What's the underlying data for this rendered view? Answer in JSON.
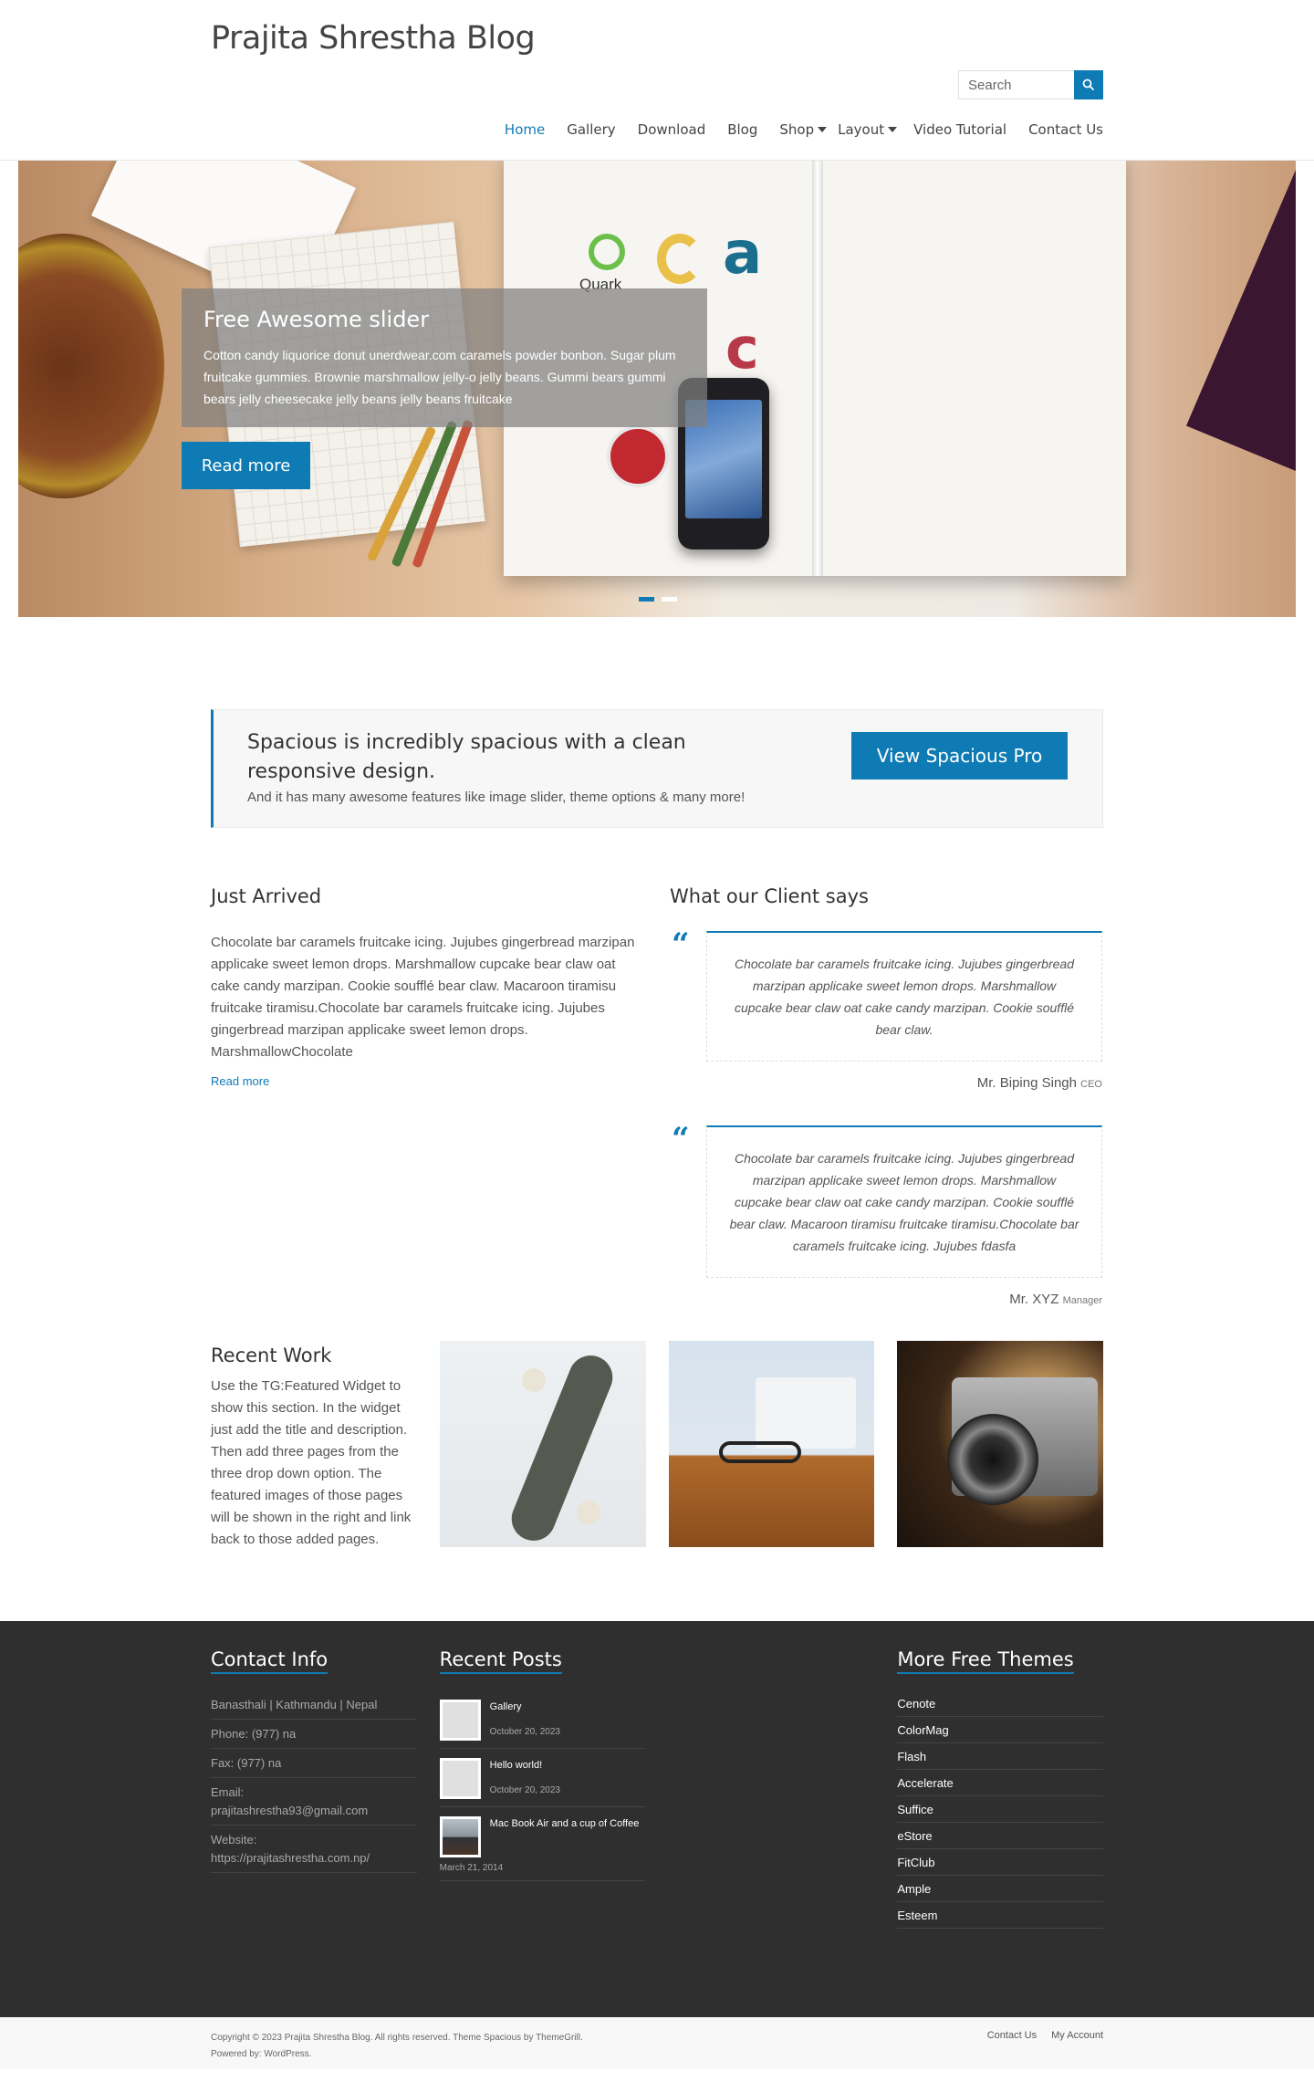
{
  "site": {
    "title": "Prajita Shrestha Blog"
  },
  "search": {
    "placeholder": "Search"
  },
  "nav": {
    "items": [
      "Home",
      "Gallery",
      "Download",
      "Blog",
      "Shop",
      "Layout",
      "Video Tutorial",
      "Contact Us"
    ],
    "active": "Home"
  },
  "slider": {
    "title": "Free Awesome slider",
    "description": "Cotton candy liquorice donut unerdwear.com caramels powder bonbon. Sugar plum fruitcake gummies. Brownie marshmallow jelly-o jelly beans. Gummi bears gummi bears jelly cheesecake jelly beans jelly beans fruitcake",
    "button": "Read more",
    "image_text": {
      "quark": "Quark"
    }
  },
  "cta": {
    "title": "Spacious is incredibly spacious with a clean responsive design.",
    "subtitle": "And it has many awesome features like image slider, theme options & many more!",
    "button": "View Spacious Pro"
  },
  "just_arrived": {
    "heading": "Just Arrived",
    "text": "Chocolate bar caramels fruitcake icing. Jujubes gingerbread marzipan applicake sweet lemon drops. Marshmallow cupcake bear claw oat cake candy marzipan. Cookie soufflé bear claw. Macaroon tiramisu fruitcake tiramisu.Chocolate bar caramels fruitcake icing. Jujubes gingerbread marzipan applicake sweet lemon drops. MarshmallowChocolate",
    "read_more": "Read more"
  },
  "testimonials": {
    "heading": "What our Client says",
    "items": [
      {
        "quote": "Chocolate bar caramels fruitcake icing. Jujubes gingerbread marzipan applicake sweet lemon drops. Marshmallow cupcake bear claw oat cake candy marzipan. Cookie soufflé bear claw.",
        "name": "Mr. Biping Singh",
        "role": "CEO"
      },
      {
        "quote": "Chocolate bar caramels fruitcake icing. Jujubes gingerbread marzipan applicake sweet lemon drops. Marshmallow cupcake bear claw oat cake candy marzipan. Cookie soufflé bear claw. Macaroon tiramisu fruitcake tiramisu.Chocolate bar caramels fruitcake icing. Jujubes fdasfa",
        "name": "Mr. XYZ",
        "role": "Manager"
      }
    ]
  },
  "recent_work": {
    "heading": "Recent Work",
    "text": "Use the TG:Featured Widget to show this section. In the widget just add the title and description. Then add three pages from the three drop down option. The featured images of those pages will be shown in the right and link back to those added pages."
  },
  "footer": {
    "contact": {
      "heading": "Contact Info",
      "address": "Banasthali | Kathmandu | Nepal",
      "phone": "Phone: (977) na",
      "fax": "Fax: (977) na",
      "email_label": "Email:",
      "email": "prajitashrestha93@gmail.com",
      "website_label": "Website:",
      "website": "https://prajitashrestha.com.np/"
    },
    "recent_posts": {
      "heading": "Recent Posts",
      "items": [
        {
          "title": "Gallery",
          "date": "October 20, 2023"
        },
        {
          "title": "Hello world!",
          "date": "October 20, 2023"
        },
        {
          "title": "Mac Book Air and a cup of Coffee",
          "date": "March 21, 2014"
        }
      ]
    },
    "themes": {
      "heading": "More Free Themes",
      "items": [
        "Cenote",
        "ColorMag",
        "Flash",
        "Accelerate",
        "Suffice",
        "eStore",
        "FitClub",
        "Ample",
        "Esteem"
      ]
    },
    "copyright": "Copyright © 2023 Prajita Shrestha Blog. All rights reserved. Theme Spacious by ThemeGrill.",
    "powered": "Powered by: WordPress.",
    "menu": [
      "Contact Us",
      "My Account"
    ]
  },
  "colors": {
    "accent": "#0f7bb4",
    "footer_bg": "#2f2f2f"
  }
}
